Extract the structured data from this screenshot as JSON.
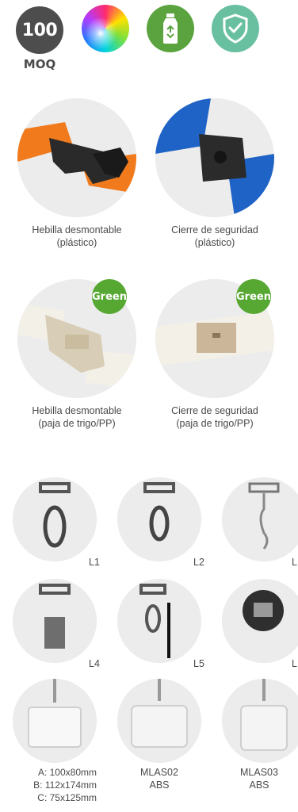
{
  "badges": {
    "moq_number": "100",
    "moq_label": "MOQ",
    "green_label": "Green"
  },
  "buckles": [
    {
      "line1": "Hebilla desmontable",
      "line2": "(plástico)"
    },
    {
      "line1": "Cierre de seguridad",
      "line2": "(plástico)"
    },
    {
      "line1": "Hebilla desmontable",
      "line2": "(paja de trigo/PP)"
    },
    {
      "line1": "Cierre de seguridad",
      "line2": "(paja de trigo/PP)"
    }
  ],
  "hooks": {
    "row1": [
      "L1",
      "L2",
      "L"
    ],
    "row2": [
      "L4",
      "L5",
      "L"
    ]
  },
  "holders": {
    "a_sizes": [
      "A: 100x80mm",
      "B: 112x174mm",
      "C: 75x125mm"
    ],
    "mlas02": {
      "code": "MLAS02",
      "material": "ABS"
    },
    "mlas03": {
      "code": "MLAS03",
      "material": "ABS"
    }
  },
  "colors": {
    "moq_grey": "#4d4d4d",
    "recycle_green": "#5aa33e",
    "shield_teal": "#68c0a0",
    "green_badge": "#56a832"
  }
}
